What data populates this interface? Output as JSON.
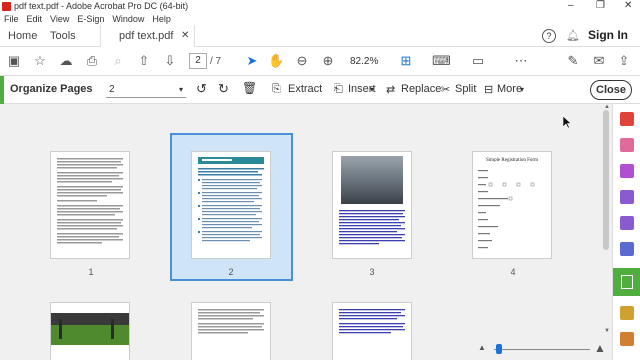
{
  "window": {
    "title": "pdf text.pdf - Adobe Acrobat Pro DC (64-bit)"
  },
  "menu": [
    "File",
    "Edit",
    "View",
    "E-Sign",
    "Window",
    "Help"
  ],
  "tabs": {
    "home": "Home",
    "tools": "Tools",
    "document": "pdf text.pdf"
  },
  "header": {
    "sign_in": "Sign In"
  },
  "toolbar": {
    "current_page": "2",
    "total_pages": "/ 7",
    "zoom": "82.2%"
  },
  "organize": {
    "title": "Organize Pages",
    "page_range": "2",
    "extract": "Extract",
    "insert": "Insert",
    "replace": "Replace",
    "split": "Split",
    "more": "More",
    "close": "Close"
  },
  "thumbnails": [
    {
      "label": "1"
    },
    {
      "label": "2"
    },
    {
      "label": "3"
    },
    {
      "label": "4",
      "form_title": "Simple Registration Form"
    }
  ],
  "colors": {
    "accent_green": "#4fae3f",
    "selection_blue": "#4a90d9",
    "acrobat_red": "#d6241a"
  }
}
